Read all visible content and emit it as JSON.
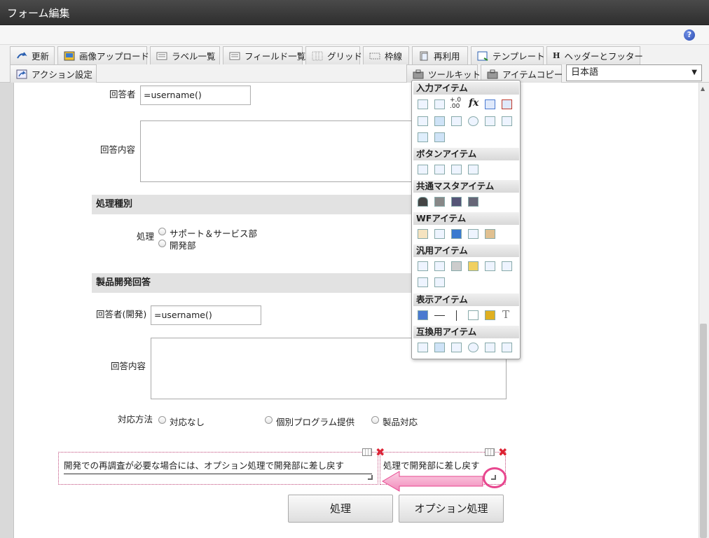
{
  "window": {
    "title": "フォーム編集"
  },
  "toolbar": {
    "row1": [
      "更新",
      "画像アップロード",
      "ラベル一覧",
      "フィールド一覧",
      "グリッド",
      "枠線",
      "再利用",
      "テンプレート",
      "ヘッダーとフッター"
    ],
    "row2_left": "アクション設定",
    "toolkit": "ツールキット",
    "item_copy": "アイテムコピー",
    "header_letter": "H",
    "language": "日本語"
  },
  "form": {
    "respondent_label": "回答者",
    "respondent_value": "=username()",
    "answer_label": "回答内容",
    "section_processing": "処理種別",
    "processing_label": "処理",
    "processing_options": [
      "サポート＆サービス部",
      "開発部"
    ],
    "section_product": "製品開発回答",
    "dev_respondent_label": "回答者(開発)",
    "dev_respondent_value": "=username()",
    "dev_answer_label": "回答内容",
    "method_label": "対応方法",
    "method_options": [
      "対応なし",
      "個別プログラム提供",
      "製品対応"
    ],
    "note_full": "開発での再調査が必要な場合には、オプション処理で開発部に差し戻す",
    "note_short": "処理で開発部に差し戻す",
    "btn_process": "処理",
    "btn_option": "オプション処理"
  },
  "palette": {
    "sections": [
      "入力アイテム",
      "ボタンアイテム",
      "共通マスタアイテム",
      "WFアイテム",
      "汎用アイテム",
      "表示アイテム",
      "互換用アイテム"
    ],
    "fx": "fx",
    "num": ".00"
  },
  "colors": {
    "accent": "#e8478f",
    "titlebar": "#333333",
    "close": "#dd2233"
  }
}
